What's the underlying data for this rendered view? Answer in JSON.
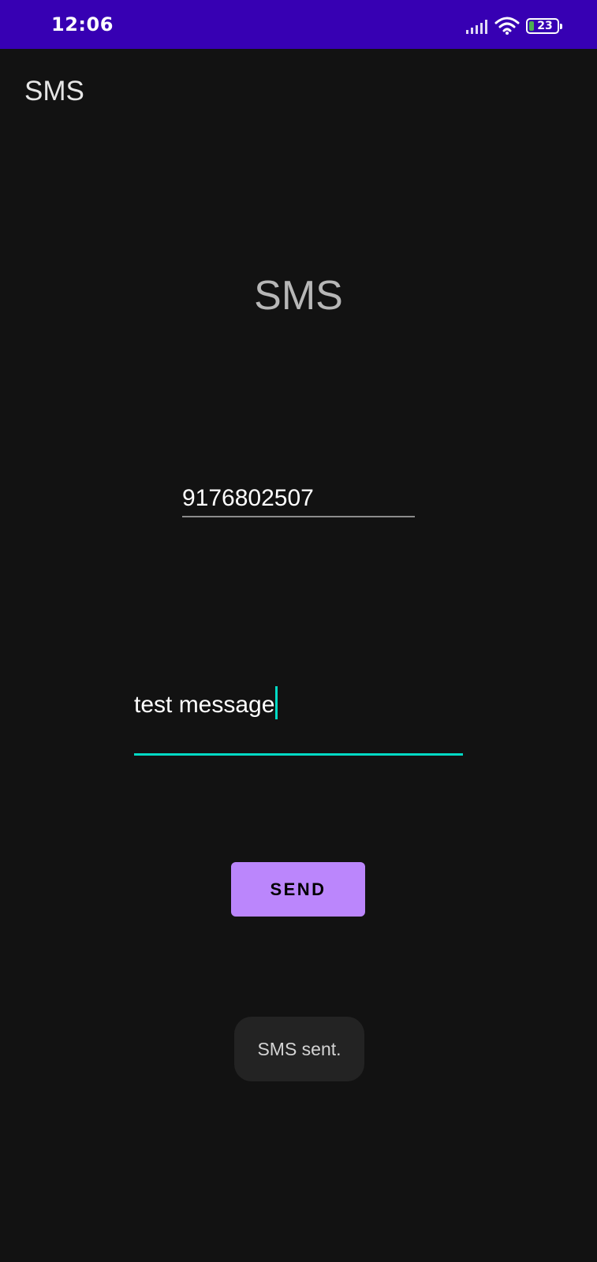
{
  "status_bar": {
    "time": "12:06",
    "battery_level": "23",
    "icons": [
      "signal-icon",
      "wifi-icon",
      "battery-icon"
    ]
  },
  "app_bar": {
    "title": "SMS"
  },
  "main": {
    "heading": "SMS",
    "phone_number": "9176802507",
    "message": "test message",
    "send_label": "SEND"
  },
  "toast": {
    "text": "SMS sent."
  },
  "colors": {
    "status_bar": "#3700B3",
    "background": "#121212",
    "accent": "#03DAC5",
    "button": "#BB86FC"
  }
}
